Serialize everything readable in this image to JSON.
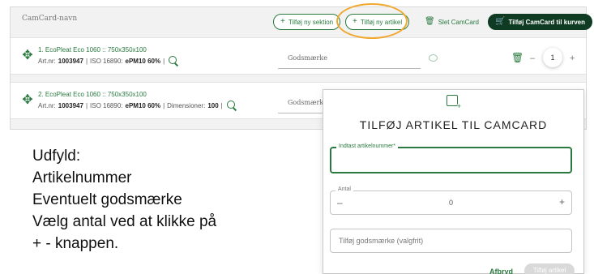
{
  "card": {
    "name": "CamCard-navn",
    "buttons": {
      "add_section": "Tilføj ny sektion",
      "add_article": "Tilføj ny artikel",
      "delete_camcard": "Slet CamCard",
      "add_to_cart": "Tilføj CamCard til kurven"
    },
    "rows": [
      {
        "name": "1. EcoPleat Eco 1060 :: 750x350x100",
        "artnr_label": "Art.nr:",
        "artnr": "1003947",
        "iso_label": "ISO 16890:",
        "iso": "ePM10 60%",
        "dim_label": "",
        "dim": "",
        "gods_placeholder": "Godsmærke",
        "qty": "1"
      },
      {
        "name": "2. EcoPleat Eco 1060 :: 750x350x100",
        "artnr_label": "Art.nr:",
        "artnr": "1003947",
        "iso_label": "ISO 16890:",
        "iso": "ePM10 60%",
        "dim_label": "Dimensioner:",
        "dim": "100",
        "gods_placeholder": "Godsmærke"
      }
    ],
    "separator": "|",
    "minus": "–",
    "plus": "+"
  },
  "instructions": [
    "Udfyld:",
    "Artikelnummer",
    "Eventuelt godsmærke",
    "Vælg antal ved at klikke på",
    "+ - knappen."
  ],
  "modal": {
    "title": "TILFØJ ARTIKEL TIL CAMCARD",
    "artnr_label": "Indtast artikelnummer*",
    "antal_label": "Antal",
    "antal_value": "0",
    "gods_placeholder": "Tilføj godsmærke (valgfrit)",
    "cancel": "Afbryd",
    "submit": "Tilføj artikel"
  },
  "colors": {
    "brand_green": "#2a7a3f",
    "dark_green": "#0e3b22",
    "highlight": "#f0a830"
  },
  "icons": [
    "move-icon",
    "search-icon",
    "comment-icon",
    "trash-icon",
    "add-card-icon",
    "cart-icon"
  ]
}
